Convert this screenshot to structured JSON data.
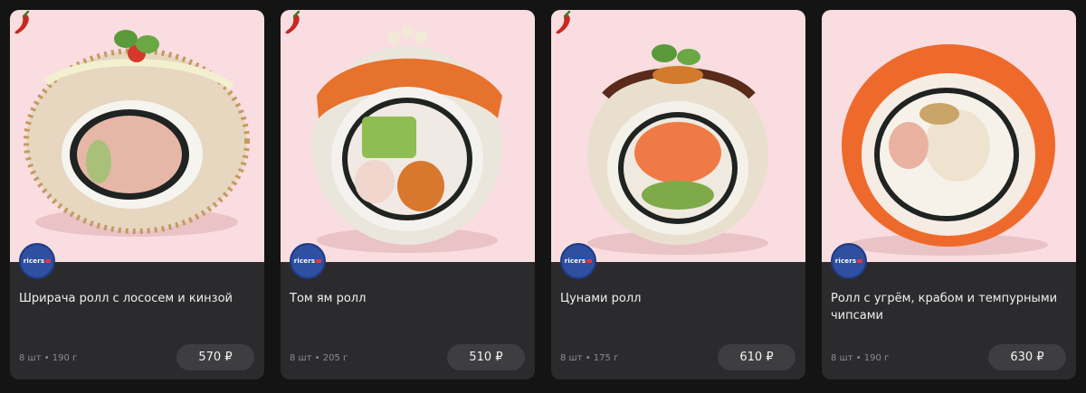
{
  "products": [
    {
      "name": "Шрирача ролл с лососем и кинзой",
      "meta": "8 шт • 190 г",
      "price": "570 ₽",
      "spicy": true,
      "logo_text": "ricers"
    },
    {
      "name": "Том ям ролл",
      "meta": "8 шт • 205 г",
      "price": "510 ₽",
      "spicy": true,
      "logo_text": "ricers"
    },
    {
      "name": "Цунами ролл",
      "meta": "8 шт • 175 г",
      "price": "610 ₽",
      "spicy": true,
      "logo_text": "ricers"
    },
    {
      "name": "Ролл с угрём, крабом и темпурными чипсами",
      "meta": "8 шт • 190 г",
      "price": "630 ₽",
      "spicy": false,
      "logo_text": "ricers"
    }
  ],
  "colors": {
    "page_background": "#141414",
    "card_background": "#2b2b2d",
    "photo_background": "#f9dde0",
    "price_button": "#3e3e40",
    "brand_blue": "#2f4fa0",
    "chili_red": "#c8281f"
  },
  "icons": {
    "spicy": "chili-pepper-icon",
    "brand": "ricers-logo"
  }
}
